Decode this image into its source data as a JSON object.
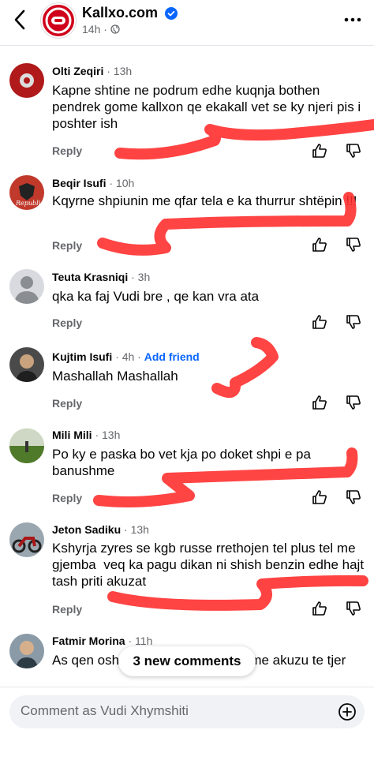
{
  "header": {
    "page_name": "Kallxo.com",
    "time": "14h",
    "verified_color": "#0866ff"
  },
  "comments": [
    {
      "name": "Olti Zeqiri",
      "time": "13h",
      "text": "Kapne shtine ne podrum edhe kuqnja bothen pendrek gome kallxon qe ekakall vet se ky njeri pis i poshter ish",
      "reply": "Reply"
    },
    {
      "name": "Beqir Isufi",
      "time": "10h",
      "text": "Kqyrne shpiunin me qfar tela e ka thurrur shtëpin !!!",
      "reply": "Reply"
    },
    {
      "name": "Teuta Krasniqi",
      "time": "3h",
      "text": "qka ka faj Vudi bre , qe kan vra ata",
      "reply": "Reply"
    },
    {
      "name": "Kujtim Isufi",
      "time": "4h",
      "add_friend": "Add friend",
      "text": "Mashallah Mashallah",
      "reply": "Reply"
    },
    {
      "name": "Mili Mili",
      "time": "13h",
      "text": "Po ky e paska bo vet kja po doket shpi e pa banushme",
      "reply": "Reply"
    },
    {
      "name": "Jeton Sadiku",
      "time": "13h",
      "text": "Kshyrja zyres se kgb russe rrethojen tel plus tel me gjemba  veq ka pagu dikan ni shish benzin edhe hajt tash priti akuzat",
      "reply": "Reply"
    },
    {
      "name": "Fatmir Morina",
      "time": "11h",
      "text": "As qen osh                               er me akuzu te tjer"
    }
  ],
  "new_comments_pill": "3 new comments",
  "composer": {
    "placeholder": "Comment as Vudi Xhymshiti"
  },
  "colors": {
    "scribble": "#ff2a2a",
    "meta_gray": "#65676b",
    "brand_red": "#d0021b"
  }
}
